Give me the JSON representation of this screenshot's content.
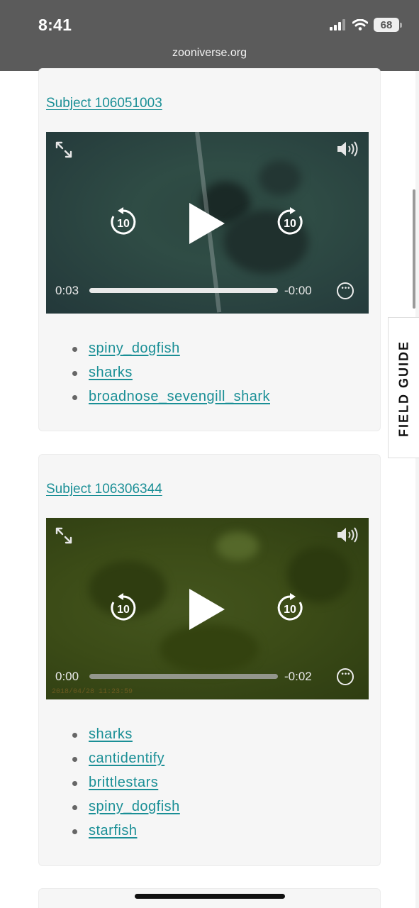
{
  "status_bar": {
    "time": "8:41",
    "battery": "68",
    "url": "zooniverse.org"
  },
  "subjects": [
    {
      "link": "Subject 106051003",
      "video": {
        "current_time": "0:03",
        "remaining_time": "-0:00",
        "progress": 1.0
      },
      "tags": [
        "spiny_dogfish",
        "sharks",
        "broadnose_sevengill_shark"
      ]
    },
    {
      "link": "Subject 106306344",
      "video": {
        "current_time": "0:00",
        "remaining_time": "-0:02",
        "progress": 0.0,
        "timestamp": "2018/04/28 11:23:59"
      },
      "tags": [
        "sharks",
        "cantidentify",
        "brittlestars",
        "spiny_dogfish",
        "starfish"
      ]
    }
  ],
  "field_guide": {
    "label": "FIELD GUIDE"
  },
  "icons": {
    "skip_back": "rewind-10-icon",
    "skip_forward": "forward-10-icon",
    "play": "play-icon",
    "expand": "expand-icon",
    "volume": "volume-icon",
    "more": "more-options-icon"
  },
  "colors": {
    "link": "#1a8f96",
    "status_bar": "#5b5b5b",
    "card_bg": "#f6f6f6"
  }
}
